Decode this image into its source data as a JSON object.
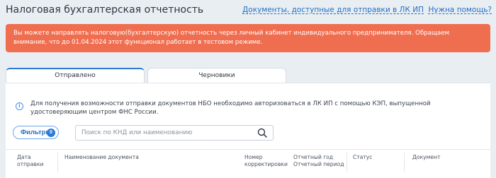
{
  "header": {
    "title": "Налоговая бухгалтерская отчетность",
    "docs_link": "Документы, доступные для отправки в ЛК ИП",
    "help_link": "Нужна помощь?"
  },
  "alert": {
    "text": "Вы можете направлять налоговую(бухгалтерскую) отчетность через личный кабинет индивидуального предпринимателя. Обращаем внимание, что до 01.04.2024 этот функционал работает в тестовом режиме."
  },
  "tabs": [
    {
      "label": "Отправлено",
      "active": true
    },
    {
      "label": "Черновики",
      "active": false
    }
  ],
  "info": {
    "icon": "info-icon",
    "text": "Для получения возможности отправки документов НБО необходимо авторизоваться в ЛК ИП с помощью КЭП, выпущенной удостоверяющим центром ФНС России."
  },
  "filters": {
    "label": "Фильтры",
    "count": "0"
  },
  "search": {
    "placeholder": "Поиск по КНД или наименованию",
    "value": "",
    "icon": "search-icon"
  },
  "table": {
    "columns": [
      "Дата\nотправки",
      "Наименование документа",
      "Номер\nкорректировки",
      "Отчетный год\nОтчетный период",
      "Статус",
      "Документ"
    ]
  },
  "colors": {
    "alert_bg": "#f06e50",
    "accent": "#2b7ad3",
    "link": "#1f6fc5",
    "page_bg": "#e9eef3"
  }
}
